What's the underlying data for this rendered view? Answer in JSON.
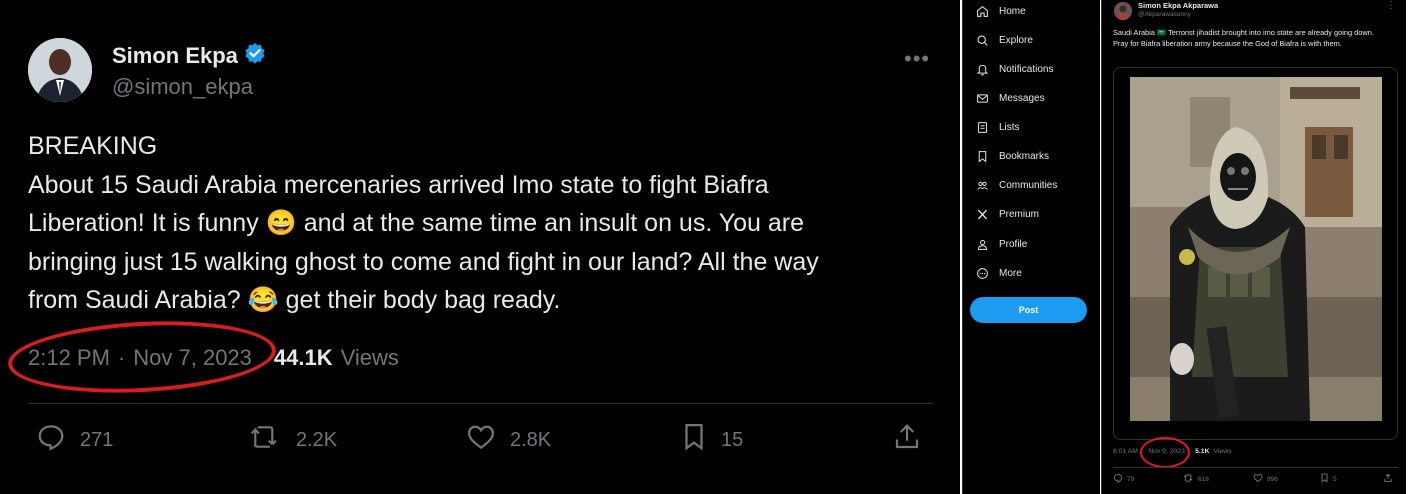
{
  "left_tweet": {
    "display_name": "Simon Ekpa",
    "handle": "@simon_ekpa",
    "more_label": "•••",
    "body_lines": [
      "BREAKING",
      "About 15 Saudi Arabia mercenaries arrived Imo state to fight Biafra",
      "Liberation! It is funny 😄 and at the same time an insult on us. You are",
      "bringing just 15 walking ghost to come and fight in our land? All the way",
      "from Saudi Arabia? 😂 get their body bag ready."
    ],
    "time": "2:12 PM",
    "separator": "·",
    "date": "Nov 7, 2023",
    "views_count": "44.1K",
    "views_label": "Views",
    "replies": "271",
    "reposts": "2.2K",
    "likes": "2.8K",
    "bookmarks": "15",
    "accent_colors": {
      "verified": "#1d9bf0",
      "annotation": "#d71d1d"
    }
  },
  "nav": {
    "items": [
      {
        "label": "Home",
        "icon": "home-icon"
      },
      {
        "label": "Explore",
        "icon": "search-icon"
      },
      {
        "label": "Notifications",
        "icon": "bell-icon"
      },
      {
        "label": "Messages",
        "icon": "mail-icon"
      },
      {
        "label": "Lists",
        "icon": "list-icon"
      },
      {
        "label": "Bookmarks",
        "icon": "bookmark-icon"
      },
      {
        "label": "Communities",
        "icon": "communities-icon"
      },
      {
        "label": "Premium",
        "icon": "x-logo-icon"
      },
      {
        "label": "Profile",
        "icon": "profile-icon"
      },
      {
        "label": "More",
        "icon": "more-circle-icon"
      }
    ],
    "post_button": "Post",
    "post_color": "#1d9bf0"
  },
  "right_tweet": {
    "display_name": "Simon Ekpa Akparawa",
    "handle": "@Akparawasunny",
    "more_label": "⋮",
    "body_line1": "Saudi Arabia 🇸🇦 Terrorist jihadist brought into imo state are already going down.",
    "body_line2": "Pray for Biafra liberation army because the God of Biafra is with them.",
    "time": "8:01 AM",
    "separator": "·",
    "date": "Nov 9, 2023",
    "views_count": "5.1K",
    "views_label": "Views",
    "replies": "79",
    "reposts": "618",
    "likes": "996",
    "bookmarks": "5"
  }
}
